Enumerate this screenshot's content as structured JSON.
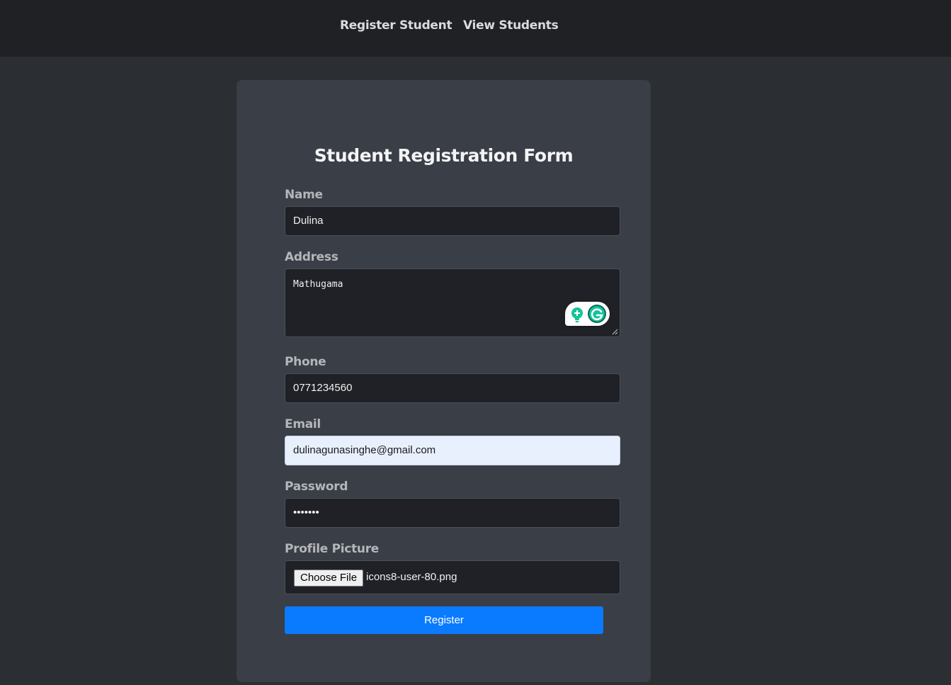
{
  "nav": {
    "register_label": "Register Student",
    "view_label": "View Students"
  },
  "form": {
    "title": "Student Registration Form",
    "name": {
      "label": "Name",
      "value": "Dulina"
    },
    "address": {
      "label": "Address",
      "value": "Mathugama"
    },
    "phone": {
      "label": "Phone",
      "value": "0771234560"
    },
    "email": {
      "label": "Email",
      "value": "dulinagunasinghe@gmail.com"
    },
    "password": {
      "label": "Password",
      "value": "•••••••"
    },
    "profile_picture": {
      "label": "Profile Picture",
      "button_label": "Choose File",
      "file_name": "icons8-user-80.png"
    },
    "submit_label": "Register"
  },
  "icons": {
    "grammarly": "grammarly-icon",
    "suggestion": "lightbulb-icon",
    "resize": "resize-handle-icon"
  },
  "colors": {
    "accent": "#0a7bff",
    "grammarly_green": "#15c39a",
    "grammarly_dark": "#0a6b5a",
    "autofill_bg": "#e8f0fe"
  }
}
